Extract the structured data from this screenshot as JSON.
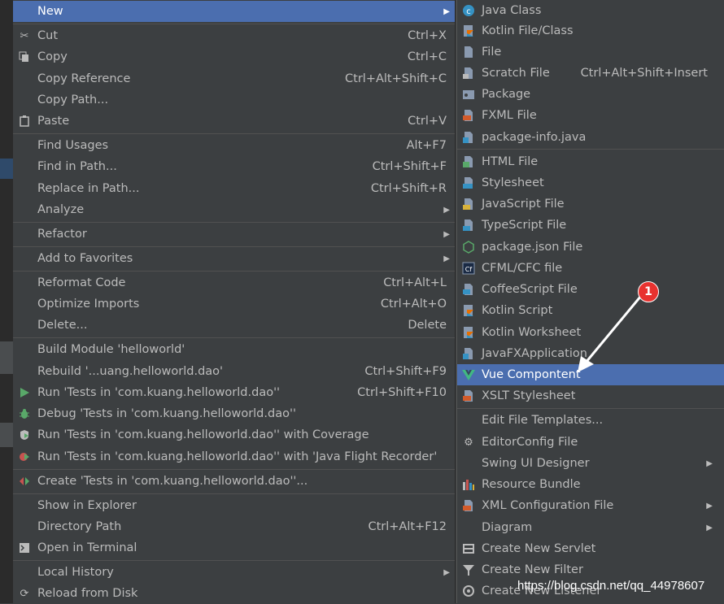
{
  "left_menu": {
    "new": {
      "label": "New"
    },
    "cut": {
      "label": "Cut",
      "shortcut": "Ctrl+X"
    },
    "copy": {
      "label": "Copy",
      "shortcut": "Ctrl+C"
    },
    "copy_reference": {
      "label": "Copy Reference",
      "shortcut": "Ctrl+Alt+Shift+C"
    },
    "copy_path": {
      "label": "Copy Path..."
    },
    "paste": {
      "label": "Paste",
      "shortcut": "Ctrl+V"
    },
    "find_usages": {
      "label": "Find Usages",
      "shortcut": "Alt+F7"
    },
    "find_in_path": {
      "label": "Find in Path...",
      "shortcut": "Ctrl+Shift+F"
    },
    "replace_in_path": {
      "label": "Replace in Path...",
      "shortcut": "Ctrl+Shift+R"
    },
    "analyze": {
      "label": "Analyze"
    },
    "refactor": {
      "label": "Refactor"
    },
    "add_to_favorites": {
      "label": "Add to Favorites"
    },
    "reformat_code": {
      "label": "Reformat Code",
      "shortcut": "Ctrl+Alt+L"
    },
    "optimize_imports": {
      "label": "Optimize Imports",
      "shortcut": "Ctrl+Alt+O"
    },
    "delete": {
      "label": "Delete...",
      "shortcut": "Delete"
    },
    "build_module": {
      "label": "Build Module 'helloworld'"
    },
    "rebuild": {
      "label": "Rebuild '...uang.helloworld.dao'",
      "shortcut": "Ctrl+Shift+F9"
    },
    "run_tests": {
      "label": "Run 'Tests in 'com.kuang.helloworld.dao''",
      "shortcut": "Ctrl+Shift+F10"
    },
    "debug_tests": {
      "label": "Debug 'Tests in 'com.kuang.helloworld.dao''"
    },
    "run_coverage": {
      "label": "Run 'Tests in 'com.kuang.helloworld.dao'' with Coverage"
    },
    "run_jfr": {
      "label": "Run 'Tests in 'com.kuang.helloworld.dao'' with 'Java Flight Recorder'"
    },
    "create_tests": {
      "label": "Create 'Tests in 'com.kuang.helloworld.dao''..."
    },
    "show_in_explorer": {
      "label": "Show in Explorer"
    },
    "directory_path": {
      "label": "Directory Path",
      "shortcut": "Ctrl+Alt+F12"
    },
    "open_in_terminal": {
      "label": "Open in Terminal"
    },
    "local_history": {
      "label": "Local History"
    },
    "reload_from_disk": {
      "label": "Reload from Disk"
    }
  },
  "right_menu": {
    "java_class": "Java Class",
    "kotlin_file": "Kotlin File/Class",
    "file": "File",
    "scratch_file": {
      "label": "Scratch File",
      "shortcut": "Ctrl+Alt+Shift+Insert"
    },
    "package": "Package",
    "fxml_file": "FXML File",
    "package_info": "package-info.java",
    "html_file": "HTML File",
    "stylesheet": "Stylesheet",
    "javascript_file": "JavaScript File",
    "typescript_file": "TypeScript File",
    "package_json": "package.json File",
    "cfml_file": "CFML/CFC file",
    "coffeescript_file": "CoffeeScript File",
    "kotlin_script": "Kotlin Script",
    "kotlin_worksheet": "Kotlin Worksheet",
    "javafx_application": "JavaFXApplication",
    "vue_component": "Vue Compontent",
    "xslt_stylesheet": "XSLT Stylesheet",
    "edit_file_templates": "Edit File Templates...",
    "editorconfig_file": "EditorConfig File",
    "swing_ui_designer": "Swing UI Designer",
    "resource_bundle": "Resource Bundle",
    "xml_configuration_file": "XML Configuration File",
    "diagram": "Diagram",
    "create_new_servlet": "Create New Servlet",
    "create_new_filter": "Create New Filter",
    "create_new_listener": "Create New Listener"
  },
  "annotation": {
    "badge": "1"
  },
  "watermark": "https://blog.csdn.net/qq_44978607",
  "colors": {
    "menu_bg": "#3c3f41",
    "selection": "#4b6eaf",
    "text": "#bbbbbb",
    "badge": "#e8322f"
  }
}
